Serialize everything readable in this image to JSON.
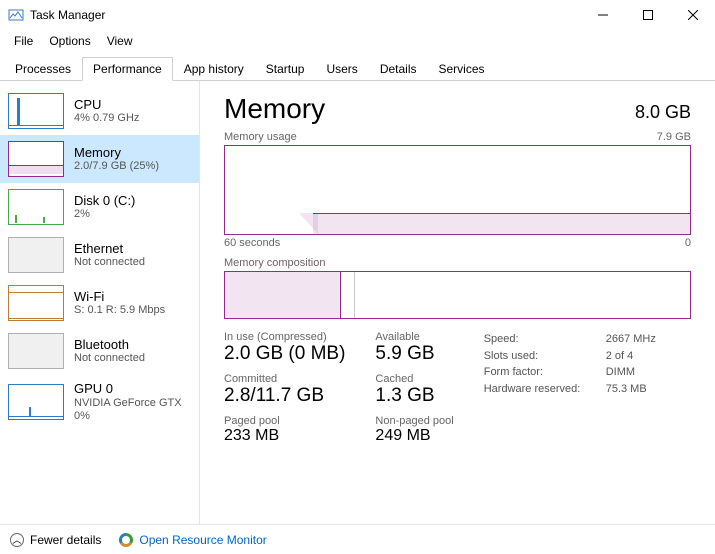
{
  "window": {
    "title": "Task Manager"
  },
  "menu": {
    "file": "File",
    "options": "Options",
    "view": "View"
  },
  "tabs": {
    "processes": "Processes",
    "performance": "Performance",
    "apphistory": "App history",
    "startup": "Startup",
    "users": "Users",
    "details": "Details",
    "services": "Services"
  },
  "sidebar": {
    "cpu": {
      "title": "CPU",
      "sub": "4% 0.79 GHz"
    },
    "memory": {
      "title": "Memory",
      "sub": "2.0/7.9 GB (25%)"
    },
    "disk": {
      "title": "Disk 0 (C:)",
      "sub": "2%"
    },
    "ethernet": {
      "title": "Ethernet",
      "sub": "Not connected"
    },
    "wifi": {
      "title": "Wi-Fi",
      "sub": "S: 0.1 R: 5.9 Mbps"
    },
    "bluetooth": {
      "title": "Bluetooth",
      "sub": "Not connected"
    },
    "gpu": {
      "title": "GPU 0",
      "sub1": "NVIDIA GeForce GTX",
      "sub2": "0%"
    }
  },
  "detail": {
    "title": "Memory",
    "capacity": "8.0 GB",
    "usage_label": "Memory usage",
    "usage_max": "7.9 GB",
    "x_left": "60 seconds",
    "x_right": "0",
    "comp_label": "Memory composition",
    "stats": {
      "inuse_label": "In use (Compressed)",
      "inuse_value": "2.0 GB (0 MB)",
      "available_label": "Available",
      "available_value": "5.9 GB",
      "committed_label": "Committed",
      "committed_value": "2.8/11.7 GB",
      "cached_label": "Cached",
      "cached_value": "1.3 GB",
      "paged_label": "Paged pool",
      "paged_value": "233 MB",
      "nonpaged_label": "Non-paged pool",
      "nonpaged_value": "249 MB"
    },
    "specs": {
      "speed_k": "Speed:",
      "speed_v": "2667 MHz",
      "slots_k": "Slots used:",
      "slots_v": "2 of 4",
      "form_k": "Form factor:",
      "form_v": "DIMM",
      "hw_k": "Hardware reserved:",
      "hw_v": "75.3 MB"
    }
  },
  "footer": {
    "fewer": "Fewer details",
    "rm": "Open Resource Monitor"
  },
  "chart_data": {
    "type": "area",
    "title": "Memory usage",
    "ylabel": "GB",
    "ylim": [
      0,
      7.9
    ],
    "xlabel": "seconds ago",
    "xlim": [
      60,
      0
    ],
    "series": [
      {
        "name": "In use",
        "x": [
          60,
          50,
          48,
          46,
          0
        ],
        "y": [
          0,
          0,
          1.9,
          2.0,
          2.0
        ]
      }
    ],
    "composition": {
      "total_gb": 7.9,
      "in_use_gb": 2.0,
      "modified_gb": 0.2,
      "standby_gb": 0,
      "free_gb": 5.7
    }
  }
}
